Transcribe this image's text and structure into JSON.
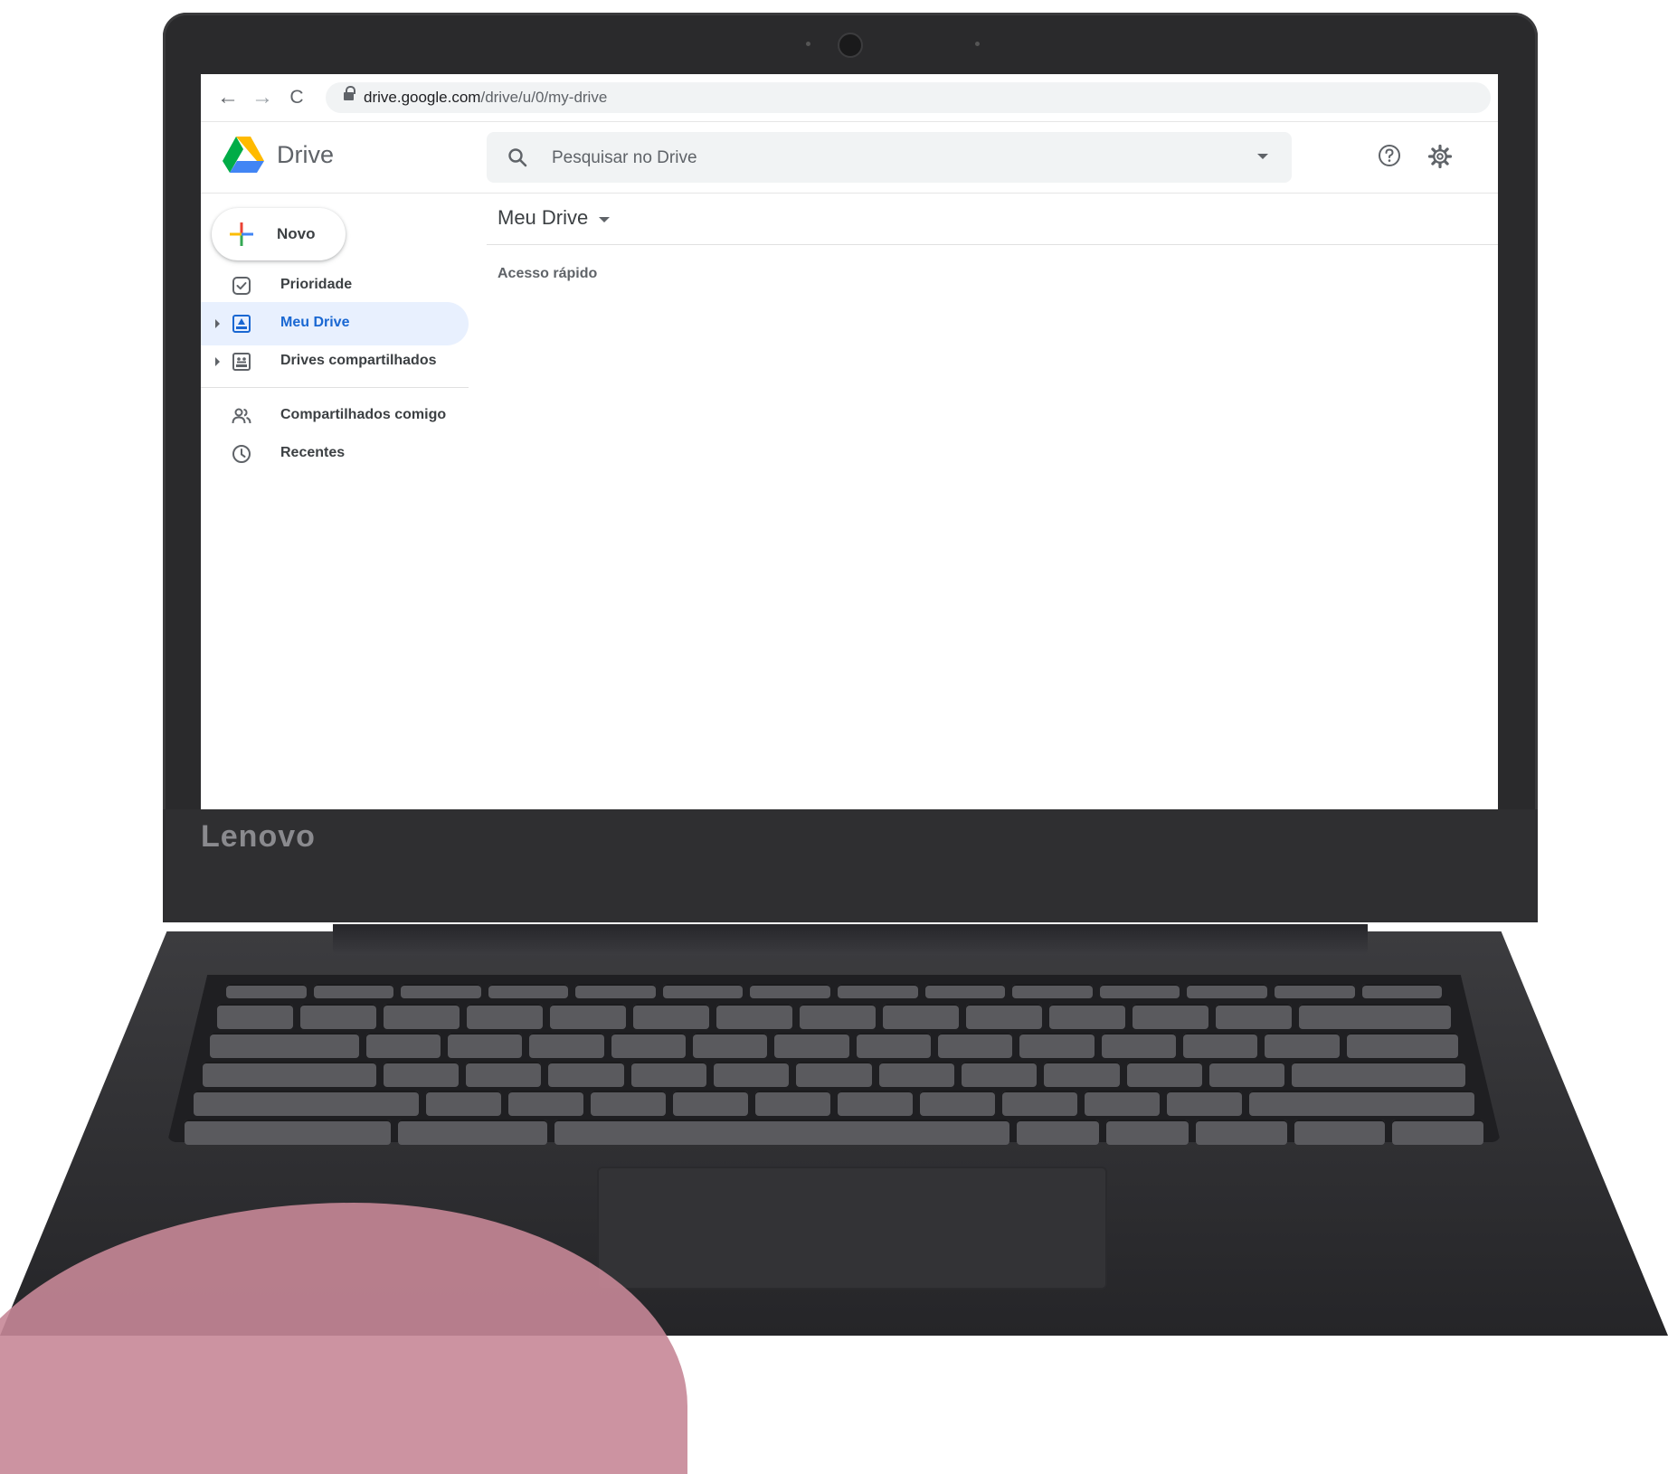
{
  "browser": {
    "url_host": "drive.google.com",
    "url_path": "/drive/u/0/my-drive",
    "back_glyph": "←",
    "forward_glyph": "→",
    "reload_glyph": "C"
  },
  "header": {
    "app_title": "Drive",
    "search_placeholder": "Pesquisar no Drive"
  },
  "sidebar": {
    "new_label": "Novo",
    "items": [
      {
        "label": "Prioridade",
        "icon": "check-box-icon"
      },
      {
        "label": "Meu Drive",
        "icon": "my-drive-icon",
        "active": true
      },
      {
        "label": "Drives compartilhados",
        "icon": "shared-drives-icon"
      },
      {
        "label": "Compartilhados comigo",
        "icon": "people-icon"
      },
      {
        "label": "Recentes",
        "icon": "clock-icon"
      }
    ]
  },
  "main": {
    "title": "Meu Drive",
    "section": "Acesso rápido"
  },
  "device": {
    "brand": "Lenovo"
  },
  "colors": {
    "accent_blue": "#1967d2",
    "active_bg": "#e8f0fe",
    "blob_pink": "#c68797"
  }
}
